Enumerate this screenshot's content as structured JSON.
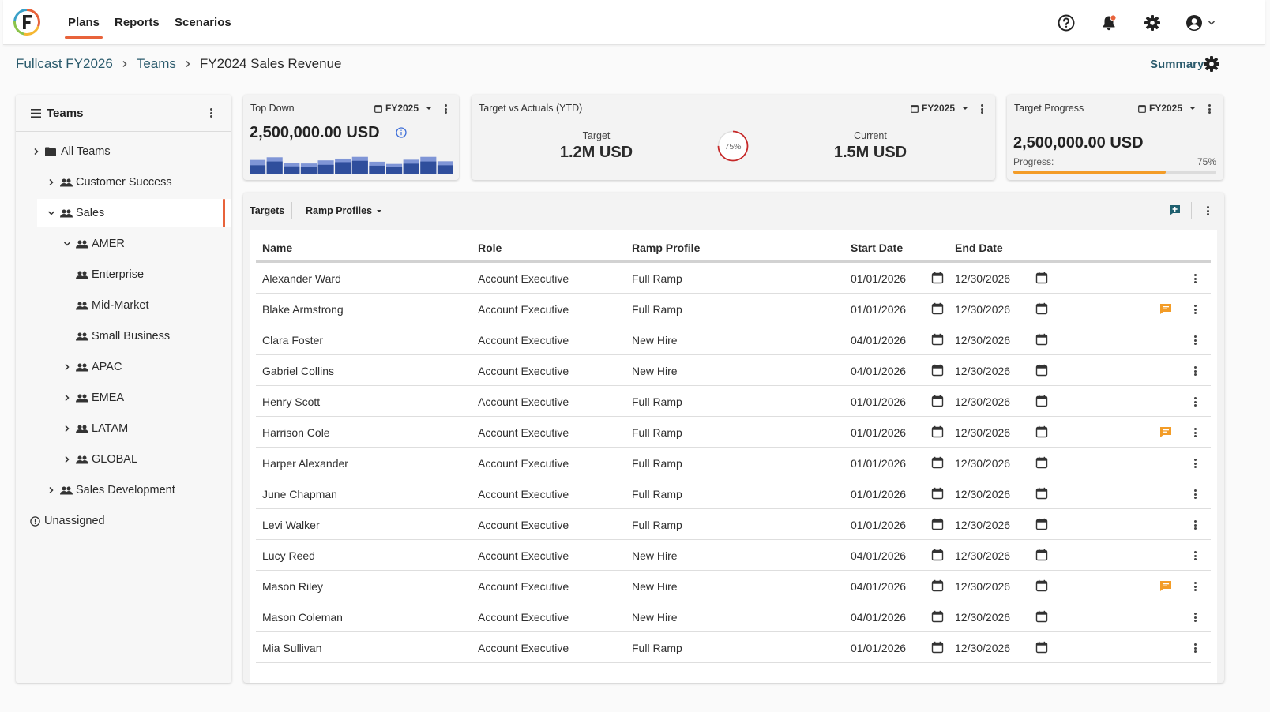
{
  "nav": {
    "tabs": [
      "Plans",
      "Reports",
      "Scenarios"
    ],
    "active": "Plans"
  },
  "breadcrumb": {
    "root": "Fullcast FY2026",
    "parent": "Teams",
    "current": "FY2024 Sales Revenue"
  },
  "view_selector": {
    "label": "Summary"
  },
  "sidebar": {
    "title": "Teams",
    "items": [
      {
        "label": "All Teams"
      },
      {
        "label": "Customer Success"
      },
      {
        "label": "Sales"
      },
      {
        "label": "AMER"
      },
      {
        "label": "Enterprise"
      },
      {
        "label": "Mid-Market"
      },
      {
        "label": "Small Business"
      },
      {
        "label": "APAC"
      },
      {
        "label": "EMEA"
      },
      {
        "label": "LATAM"
      },
      {
        "label": "GLOBAL"
      },
      {
        "label": "Sales Development"
      },
      {
        "label": "Unassigned"
      }
    ],
    "selected": "Sales"
  },
  "cards": {
    "top_down": {
      "title": "Top Down",
      "fy": "FY2025",
      "value": "2,500,000.00 USD",
      "mini_bars": [
        {
          "total": 0.62,
          "inner": 0.38
        },
        {
          "total": 0.74,
          "inner": 0.55
        },
        {
          "total": 0.5,
          "inner": 0.33
        },
        {
          "total": 0.46,
          "inner": 0.31
        },
        {
          "total": 0.6,
          "inner": 0.4
        },
        {
          "total": 0.68,
          "inner": 0.52
        },
        {
          "total": 0.76,
          "inner": 0.58
        },
        {
          "total": 0.54,
          "inner": 0.36
        },
        {
          "total": 0.44,
          "inner": 0.3
        },
        {
          "total": 0.63,
          "inner": 0.45
        },
        {
          "total": 0.76,
          "inner": 0.55
        },
        {
          "total": 0.56,
          "inner": 0.38
        }
      ],
      "colors": {
        "light": "#7f95d6",
        "dark": "#2f4e9c"
      }
    },
    "target_vs_actuals": {
      "title": "Target vs Actuals (YTD)",
      "fy": "FY2025",
      "target_label": "Target",
      "target_value": "1.2M USD",
      "current_label": "Current",
      "current_value": "1.5M USD",
      "percent_label": "75%",
      "percent": 0.75
    },
    "target_progress": {
      "title": "Target Progress",
      "fy": "FY2025",
      "value": "2,500,000.00 USD",
      "progress_label": "Progress:",
      "percent_label": "75%",
      "percent": 0.75,
      "color": "#f39c27"
    }
  },
  "table": {
    "tab": "Targets",
    "filter": "Ramp Profiles",
    "columns": [
      "Name",
      "Role",
      "Ramp Profile",
      "Start Date",
      "End Date"
    ],
    "rows": [
      {
        "name": "Alexander Ward",
        "role": "Account Executive",
        "ramp": "Full Ramp",
        "start": "01/01/2026",
        "end": "12/30/2026",
        "comment": false
      },
      {
        "name": "Blake Armstrong",
        "role": "Account Executive",
        "ramp": "Full Ramp",
        "start": "01/01/2026",
        "end": "12/30/2026",
        "comment": true
      },
      {
        "name": "Clara Foster",
        "role": "Account Executive",
        "ramp": "New Hire",
        "start": "04/01/2026",
        "end": "12/30/2026",
        "comment": false
      },
      {
        "name": "Gabriel Collins",
        "role": "Account Executive",
        "ramp": "New Hire",
        "start": "04/01/2026",
        "end": "12/30/2026",
        "comment": false
      },
      {
        "name": "Henry Scott",
        "role": "Account Executive",
        "ramp": "Full Ramp",
        "start": "01/01/2026",
        "end": "12/30/2026",
        "comment": false
      },
      {
        "name": "Harrison Cole",
        "role": "Account Executive",
        "ramp": "Full Ramp",
        "start": "01/01/2026",
        "end": "12/30/2026",
        "comment": true
      },
      {
        "name": "Harper Alexander",
        "role": "Account Executive",
        "ramp": "Full Ramp",
        "start": "01/01/2026",
        "end": "12/30/2026",
        "comment": false
      },
      {
        "name": "June Chapman",
        "role": "Account Executive",
        "ramp": "Full Ramp",
        "start": "01/01/2026",
        "end": "12/30/2026",
        "comment": false
      },
      {
        "name": "Levi Walker",
        "role": "Account Executive",
        "ramp": "Full Ramp",
        "start": "01/01/2026",
        "end": "12/30/2026",
        "comment": false
      },
      {
        "name": "Lucy Reed",
        "role": "Account Executive",
        "ramp": "New Hire",
        "start": "04/01/2026",
        "end": "12/30/2026",
        "comment": false
      },
      {
        "name": "Mason Riley",
        "role": "Account Executive",
        "ramp": "New Hire",
        "start": "04/01/2026",
        "end": "12/30/2026",
        "comment": true
      },
      {
        "name": "Mason Coleman",
        "role": "Account Executive",
        "ramp": "New Hire",
        "start": "04/01/2026",
        "end": "12/30/2026",
        "comment": false
      },
      {
        "name": "Mia Sullivan",
        "role": "Account Executive",
        "ramp": "Full Ramp",
        "start": "01/01/2026",
        "end": "12/30/2026",
        "comment": false
      }
    ]
  },
  "icons": [
    "help-icon",
    "bell-icon",
    "gear-icon",
    "account-icon",
    "chevron-down-icon",
    "menu-icon",
    "folder-icon",
    "people-icon",
    "info-icon",
    "calendar-icon",
    "comment-icon",
    "add-comment-icon",
    "kebab-icon"
  ],
  "colors": {
    "accent": "#e8633b",
    "link": "#2a5a6c",
    "comment": "#f39c27",
    "notification_dot": "#e8633b"
  }
}
